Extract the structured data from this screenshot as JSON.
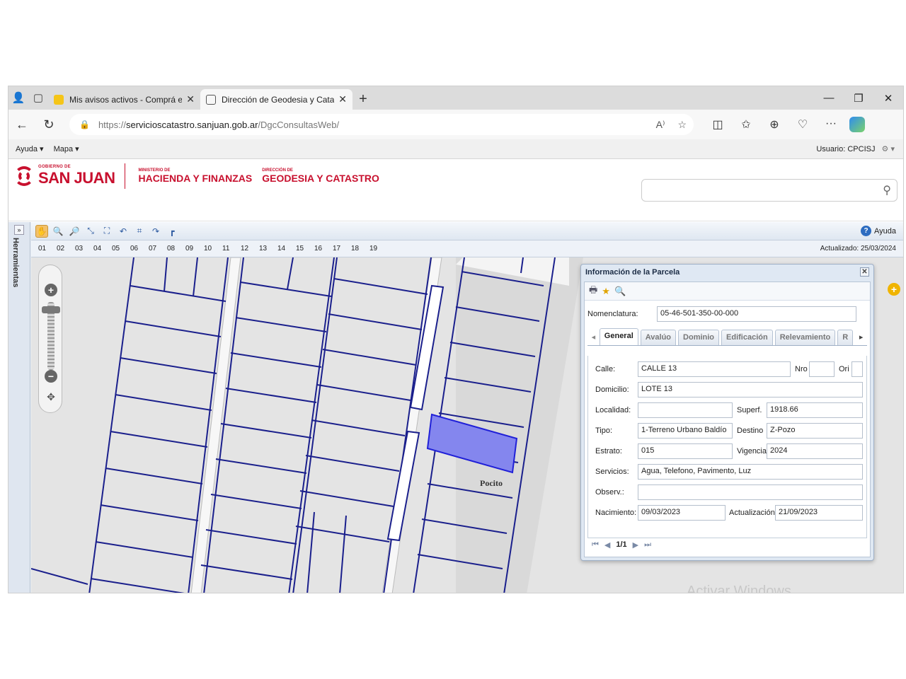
{
  "browser": {
    "tabs": [
      {
        "title": "Mis avisos activos - Comprá en S",
        "favicon_color": "#f5c518"
      },
      {
        "title": "Dirección de Geodesia y Catastro",
        "favicon_color": "#ffffff"
      }
    ],
    "url_scheme": "https://",
    "url_host": "servicioscatastro.sanjuan.gob.ar",
    "url_path": "/DgcConsultasWeb/"
  },
  "menu": {
    "items": [
      "Ayuda ▾",
      "Mapa ▾"
    ],
    "user": "Usuario: CPCISJ"
  },
  "header": {
    "logo_small": "GOBIERNO DE",
    "logo_big": "SAN JUAN",
    "ministry_small": "MINISTERIO DE",
    "ministry_big": "HACIENDA Y FINANZAS",
    "direction_small": "DIRECCIÓN DE",
    "direction_big": "GEODESIA Y CATASTRO",
    "search_value": ""
  },
  "side": {
    "label": "Herramientas"
  },
  "toolbar": {
    "help": "Ayuda"
  },
  "layers": {
    "numbers": [
      "01",
      "02",
      "03",
      "04",
      "05",
      "06",
      "07",
      "08",
      "09",
      "10",
      "11",
      "12",
      "13",
      "14",
      "15",
      "16",
      "17",
      "18",
      "19"
    ],
    "updated": "Actualizado: 25/03/2024"
  },
  "map": {
    "place_label": "Pocito",
    "watermark": "Activar Windows",
    "parcel_color": "#8486ee",
    "line_color": "#1a1f8c"
  },
  "panel": {
    "title": "Información de la Parcela",
    "nomenclatura_label": "Nomenclatura:",
    "nomenclatura_value": "05-46-501-350-00-000",
    "tabs": [
      "General",
      "Avalúo",
      "Dominio",
      "Edificación",
      "Relevamiento",
      "R"
    ],
    "fields": {
      "calle_label": "Calle:",
      "calle": "CALLE 13",
      "nro_label": "Nro",
      "nro": "",
      "ori_label": "Ori",
      "ori": "",
      "domicilio_label": "Domicilio:",
      "domicilio": "LOTE 13",
      "localidad_label": "Localidad:",
      "localidad": "",
      "superf_label": "Superf.",
      "superf": "1918.66",
      "tipo_label": "Tipo:",
      "tipo": "1-Terreno Urbano Baldío",
      "destino_label": "Destino",
      "destino": "Z-Pozo",
      "estrato_label": "Estrato:",
      "estrato": "015",
      "vigencia_label": "Vigencia",
      "vigencia": "2024",
      "servicios_label": "Servicios:",
      "servicios": "Agua, Telefono, Pavimento, Luz",
      "observ_label": "Observ.:",
      "observ": "",
      "nacimiento_label": "Nacimiento:",
      "nacimiento": "09/03/2023",
      "actualizacion_label": "Actualización",
      "actualizacion": "21/09/2023"
    },
    "pager": "1/1"
  }
}
